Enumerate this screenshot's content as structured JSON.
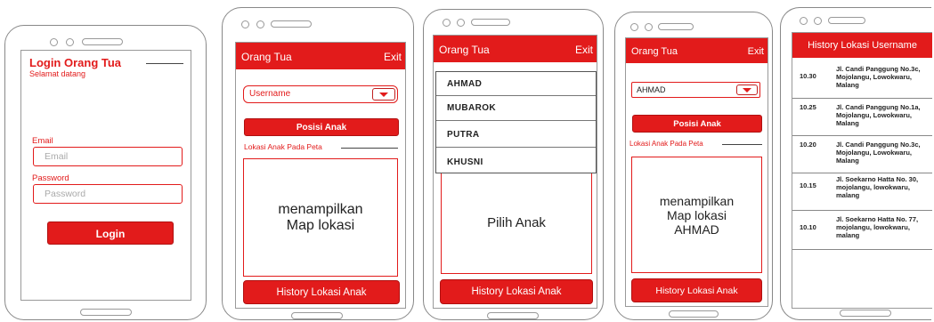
{
  "login": {
    "title": "Login Orang Tua",
    "subtitle": "Selamat datang",
    "email_label": "Email",
    "email_placeholder": "Email",
    "password_label": "Password",
    "password_placeholder": "Password",
    "login_button": "Login"
  },
  "screen2": {
    "header_title": "Orang Tua",
    "exit_label": "Exit",
    "select_value": "Username",
    "posisi_button": "Posisi Anak",
    "section_label": "Lokasi Anak Pada Peta",
    "map_text_1": "menampilkan",
    "map_text_2": "Map lokasi",
    "history_button": "History Lokasi Anak"
  },
  "screen3": {
    "header_title": "Orang Tua",
    "exit_label": "Exit",
    "options": [
      "AHMAD",
      "MUBAROK",
      "PUTRA",
      "KHUSNI"
    ],
    "map_text": "Pilih Anak",
    "history_button": "History Lokasi Anak"
  },
  "screen4": {
    "header_title": "Orang Tua",
    "exit_label": "Exit",
    "select_value": "AHMAD",
    "posisi_button": "Posisi Anak",
    "section_label": "Lokasi Anak Pada Peta",
    "map_text_1": "menampilkan",
    "map_text_2": "Map lokasi",
    "map_text_3": "AHMAD",
    "history_button": "History Lokasi Anak"
  },
  "screen5": {
    "header_title": "History Lokasi Username",
    "rows": [
      {
        "time": "10.30",
        "address": "Jl. Candi Panggung No.3c, Mojolangu, Lowokwaru, Malang"
      },
      {
        "time": "10.25",
        "address": "Jl. Candi Panggung No.1a, Mojolangu, Lowokwaru, Malang"
      },
      {
        "time": "10.20",
        "address": "Jl. Candi Panggung No.3c, Mojolangu, Lowokwaru, Malang"
      },
      {
        "time": "10.15",
        "address": "Jl. Soekarno Hatta No. 30, mojolangu, lowokwaru, malang"
      },
      {
        "time": "10.10",
        "address": "Jl. Soekarno Hatta No. 77, mojolangu, lowokwaru, malang"
      }
    ]
  },
  "colors": {
    "accent": "#e21b1b",
    "frame": "#888888"
  },
  "icons": {
    "dropdown": "chevron-down-icon",
    "camera": "camera-icon",
    "speaker": "speaker-icon"
  }
}
